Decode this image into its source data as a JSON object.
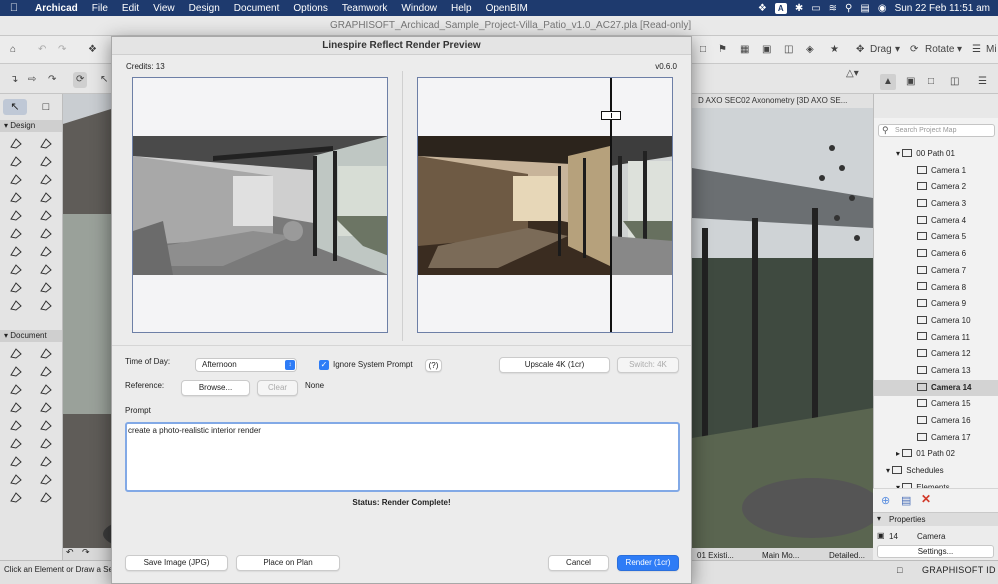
{
  "menubar": {
    "app": "Archicad",
    "items": [
      "File",
      "Edit",
      "View",
      "Design",
      "Document",
      "Options",
      "Teamwork",
      "Window",
      "Help",
      "OpenBIM"
    ],
    "clock": "Sun 22 Feb  11:51 am",
    "input_badge": "A"
  },
  "window": {
    "title": "GRAPHISOFT_Archicad_Sample_Project-Villa_Patio_v1.0_AC27.pla [Read-only]"
  },
  "toolbar": {
    "drag": "Drag",
    "rotate": "Rotate",
    "mirror_partial": "Mi"
  },
  "left_panel": {
    "design": "Design",
    "document": "Document"
  },
  "viewport_tabs": {
    "axo": "D AXO SEC02 Axonometry [3D AXO SE..."
  },
  "navigator": {
    "search_placeholder": "Search Project Map",
    "path01": "00 Path 01",
    "cameras": [
      "Camera 1",
      "Camera 2",
      "Camera 3",
      "Camera 4",
      "Camera 5",
      "Camera 6",
      "Camera 7",
      "Camera 8",
      "Camera 9",
      "Camera 10",
      "Camera 11",
      "Camera 12",
      "Camera 13",
      "Camera 14",
      "Camera 15",
      "Camera 16",
      "Camera 17"
    ],
    "path02": "01 Path 02",
    "schedules": "Schedules",
    "elements": "Elements"
  },
  "properties": {
    "header": "Properties",
    "id": "14",
    "type": "Camera",
    "settings": "Settings..."
  },
  "statusbar": {
    "hint": "Click an Element or Draw a Se",
    "tab1": "01 Existi...",
    "tab2": "Main Mo...",
    "tab3": "Detailed...",
    "brand": "GRAPHISOFT ID"
  },
  "dialog": {
    "title": "Linespire Reflect Render Preview",
    "credits": "Credits: 13",
    "version": "v0.6.0",
    "time_of_day_label": "Time of Day:",
    "time_of_day_value": "Afternoon",
    "ignore_prompt_label": "Ignore System Prompt",
    "help_button": "(?)",
    "upscale_button": "Upscale 4K (1cr)",
    "switch_button": "Switch: 4K",
    "reference_label": "Reference:",
    "browse_button": "Browse...",
    "clear_button": "Clear",
    "reference_value": "None",
    "prompt_label": "Prompt",
    "prompt_value": "create a photo-realistic interior render",
    "status": "Status: Render Complete!",
    "save_button": "Save Image (JPG)",
    "place_button": "Place on Plan",
    "cancel_button": "Cancel",
    "render_button": "Render (1cr)"
  },
  "colors": {
    "menubar": "#1e3a6e",
    "accent": "#2e7cf6",
    "frame_border": "#6d7fa6"
  }
}
